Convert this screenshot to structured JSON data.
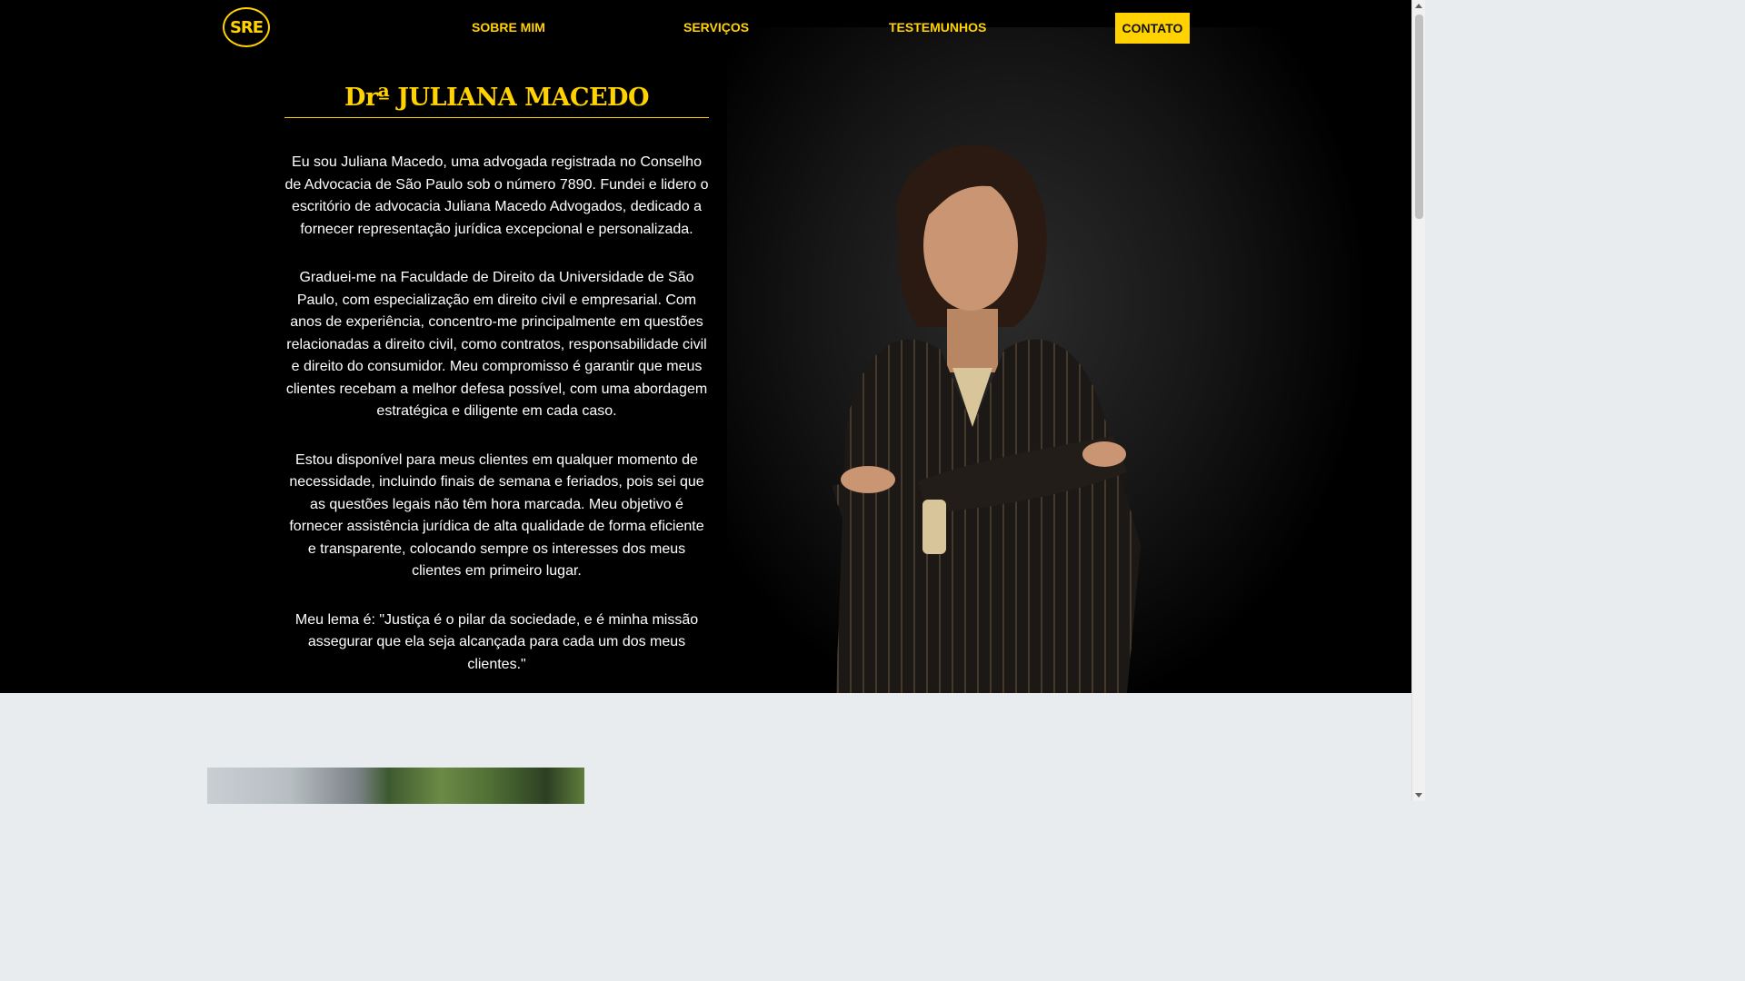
{
  "nav": {
    "logo_text": "SRE",
    "links": [
      "SOBRE MIM",
      "SERVIÇOS",
      "TESTEMUNHOS"
    ],
    "contact_label": "CONTATO"
  },
  "bio": {
    "title": "Drª JULIANA MACEDO",
    "paragraphs": [
      "Eu sou Juliana Macedo, uma advogada registrada no Conselho de Advocacia de São Paulo sob o número 7890. Fundei e lidero o escritório de advocacia Juliana Macedo Advogados, dedicado a fornecer representação jurídica excepcional e personalizada.",
      "Graduei-me na Faculdade de Direito da Universidade de São Paulo, com especialização em direito civil e empresarial. Com anos de experiência, concentro-me principalmente em questões relacionadas a direito civil, como contratos, responsabilidade civil e direito do consumidor. Meu compromisso é garantir que meus clientes recebam a melhor defesa possível, com uma abordagem estratégica e diligente em cada caso.",
      "Estou disponível para meus clientes em qualquer momento de necessidade, incluindo finais de semana e feriados, pois sei que as questões legais não têm hora marcada. Meu objetivo é fornecer assistência jurídica de alta qualidade de forma eficiente e transparente, colocando sempre os interesses dos meus clientes em primeiro lugar.",
      "Meu lema é: \"Justiça é o pilar da sociedade, e é minha missão assegurar que ela seja alcançada para cada um dos meus clientes.\""
    ]
  },
  "colors": {
    "accent": "#ffd200",
    "hero_background": "#000000",
    "section_background": "#e9ecef"
  }
}
